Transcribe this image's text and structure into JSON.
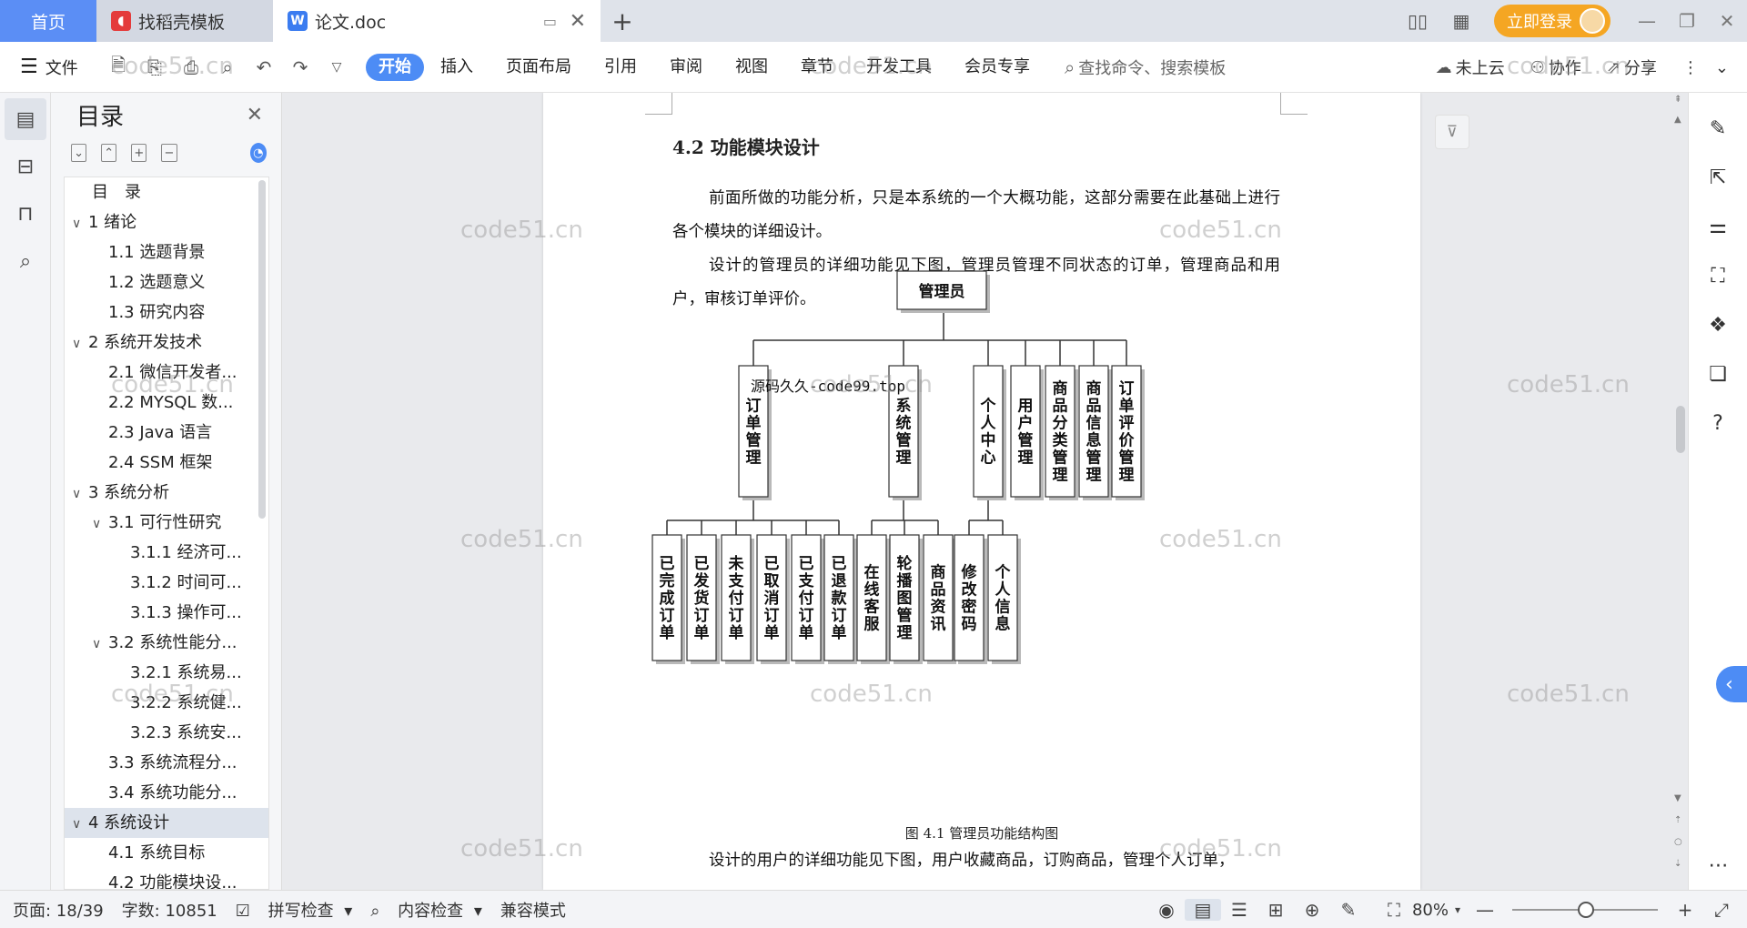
{
  "tabs": {
    "home": "首页",
    "template": "找稻壳模板",
    "doc": "论文.doc",
    "login": "立即登录"
  },
  "ribbon": {
    "file": "文件",
    "tabs": [
      "开始",
      "插入",
      "页面布局",
      "引用",
      "审阅",
      "视图",
      "章节",
      "开发工具",
      "会员专享"
    ],
    "search_placeholder": "查找命令、搜索模板",
    "cloud": "未上云",
    "collab": "协作",
    "share": "分享"
  },
  "toc": {
    "title": "目录",
    "items": [
      {
        "label": "目　录",
        "level": 1,
        "caret": ""
      },
      {
        "label": "1  绪论",
        "level": 0,
        "caret": "∨"
      },
      {
        "label": "1.1  选题背景",
        "level": 1,
        "caret": ""
      },
      {
        "label": "1.2  选题意义",
        "level": 1,
        "caret": ""
      },
      {
        "label": "1.3  研究内容",
        "level": 1,
        "caret": ""
      },
      {
        "label": "2  系统开发技术",
        "level": 0,
        "caret": "∨"
      },
      {
        "label": "2.1 微信开发者...",
        "level": 1,
        "caret": ""
      },
      {
        "label": "2.2 MYSQL 数...",
        "level": 1,
        "caret": ""
      },
      {
        "label": "2.3 Java 语言",
        "level": 1,
        "caret": ""
      },
      {
        "label": "2.4 SSM 框架",
        "level": 1,
        "caret": ""
      },
      {
        "label": "3  系统分析",
        "level": 0,
        "caret": "∨"
      },
      {
        "label": "3.1 可行性研究",
        "level": 1,
        "caret": "∨"
      },
      {
        "label": "3.1.1 经济可...",
        "level": 2,
        "caret": ""
      },
      {
        "label": "3.1.2 时间可...",
        "level": 2,
        "caret": ""
      },
      {
        "label": "3.1.3 操作可...",
        "level": 2,
        "caret": ""
      },
      {
        "label": "3.2 系统性能分...",
        "level": 1,
        "caret": "∨"
      },
      {
        "label": "3.2.1 系统易...",
        "level": 2,
        "caret": ""
      },
      {
        "label": "3.2.2 系统健...",
        "level": 2,
        "caret": ""
      },
      {
        "label": "3.2.3 系统安...",
        "level": 2,
        "caret": ""
      },
      {
        "label": "3.3  系统流程分...",
        "level": 1,
        "caret": ""
      },
      {
        "label": "3.4 系统功能分...",
        "level": 1,
        "caret": ""
      },
      {
        "label": "4  系统设计",
        "level": 0,
        "caret": "∨",
        "selected": true
      },
      {
        "label": "4.1 系统目标",
        "level": 1,
        "caret": ""
      },
      {
        "label": "4.2 功能模块设...",
        "level": 1,
        "caret": ""
      }
    ]
  },
  "doc": {
    "heading": "4.2 功能模块设计",
    "p1": "前面所做的功能分析，只是本系统的一个大概功能，这部分需要在此基础上进行各个模块的详细设计。",
    "p2": "设计的管理员的详细功能见下图，管理员管理不同状态的订单，管理商品和用户，审核订单评价。",
    "caption": "图 4.1  管理员功能结构图",
    "p3": "设计的用户的详细功能见下图，用户收藏商品，订购商品，管理个人订单，",
    "overlay_text": "源码久久-code99.top",
    "org_chart": {
      "root": "管理员",
      "level1": [
        "订单管理",
        "系统管理",
        "个人中心",
        "用户管理",
        "商品分类管理",
        "商品信息管理",
        "订单评价管理"
      ],
      "level2": {
        "订单管理": [
          "已完成订单",
          "已发货订单",
          "未支付订单",
          "已取消订单",
          "已支付订单",
          "已退款订单"
        ],
        "系统管理": [
          "在线客服",
          "轮播图管理",
          "商品资讯"
        ],
        "个人中心": [
          "修改密码",
          "个人信息"
        ]
      }
    }
  },
  "status": {
    "page": "页面: 18/39",
    "words": "字数: 10851",
    "spell": "拼写检查",
    "content_check": "内容检查",
    "compat": "兼容模式",
    "zoom": "80%"
  },
  "watermark": "code51.cn"
}
